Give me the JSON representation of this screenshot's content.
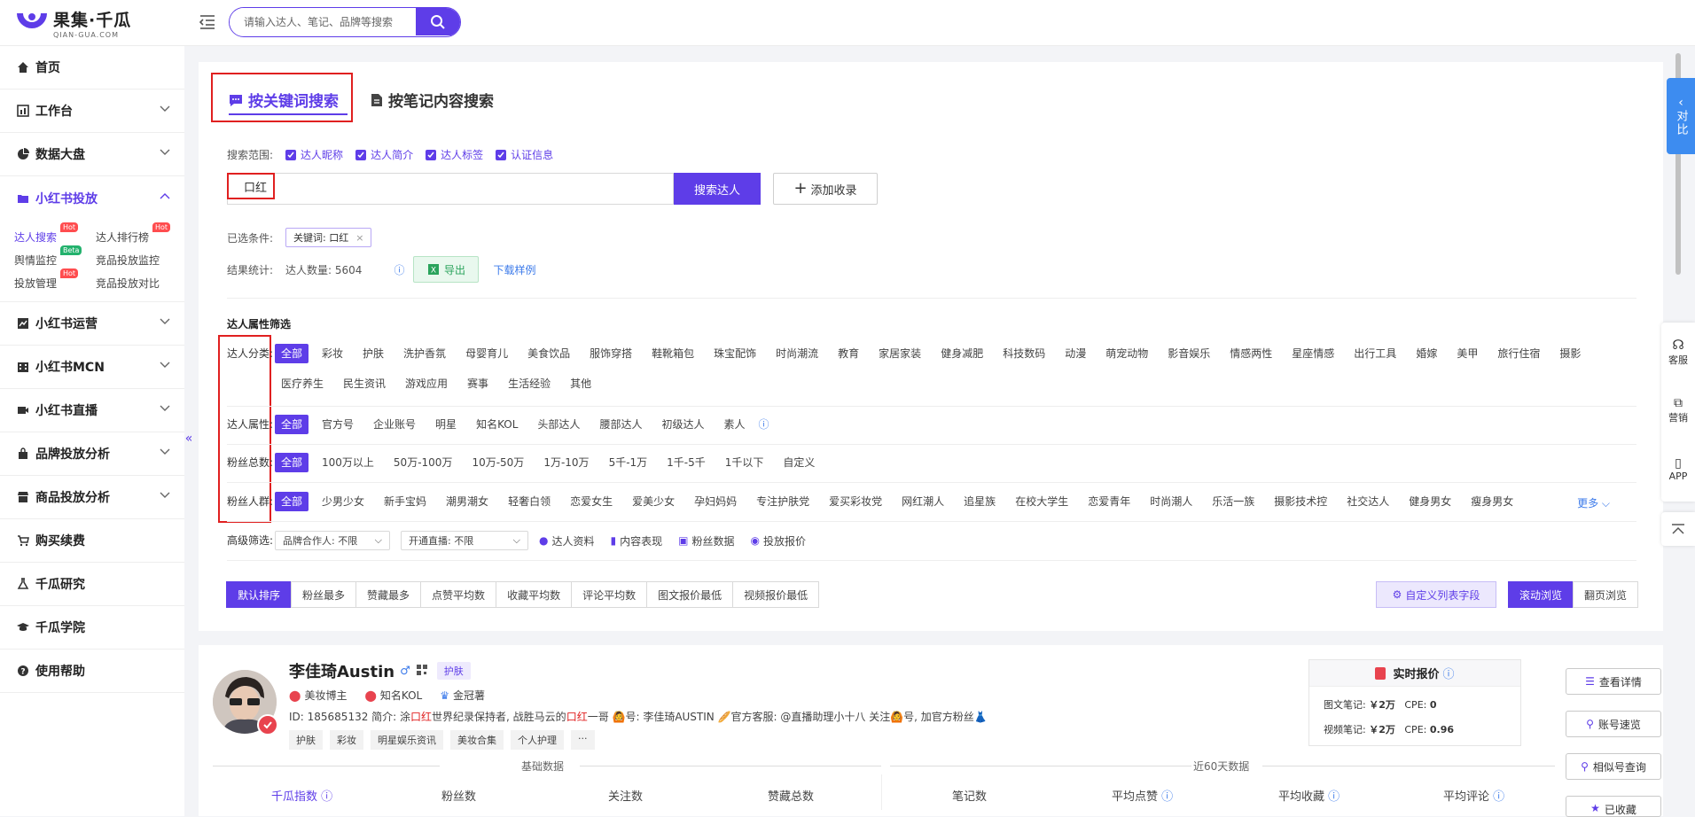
{
  "brand": {
    "title": "果集·千瓜",
    "subtitle": "QIAN-GUA.COM",
    "accent": "#5e3de8"
  },
  "search": {
    "placeholder": "请输入达人、笔记、品牌等搜索"
  },
  "sidebar": {
    "items": [
      {
        "label": "首页",
        "icon": "home-icon"
      },
      {
        "label": "工作台",
        "icon": "dashboard-icon"
      },
      {
        "label": "数据大盘",
        "icon": "pie-chart-icon"
      },
      {
        "label": "小红书投放",
        "icon": "folder-icon"
      }
    ],
    "sub": [
      {
        "label": "达人搜索",
        "badge": "Hot"
      },
      {
        "label": "达人排行榜",
        "badge": "Hot"
      },
      {
        "label": "舆情监控",
        "badge": "Beta"
      },
      {
        "label": "竞品投放监控",
        "badge": ""
      },
      {
        "label": "投放管理",
        "badge": "Hot"
      },
      {
        "label": "竞品投放对比",
        "badge": ""
      }
    ],
    "items2": [
      {
        "label": "小红书运营"
      },
      {
        "label": "小红书MCN"
      },
      {
        "label": "小红书直播"
      },
      {
        "label": "品牌投放分析"
      },
      {
        "label": "商品投放分析"
      },
      {
        "label": "购买续费"
      },
      {
        "label": "千瓜研究"
      },
      {
        "label": "千瓜学院"
      },
      {
        "label": "使用帮助"
      }
    ]
  },
  "tabs": {
    "keyword": "按关键词搜索",
    "note": "按笔记内容搜索"
  },
  "scope": {
    "label": "搜索范围:",
    "options": [
      "达人昵称",
      "达人简介",
      "达人标签",
      "认证信息"
    ]
  },
  "keyword": {
    "value": "口红",
    "search_btn": "搜索达人",
    "add_btn": "添加收录"
  },
  "conditions": {
    "label": "已选条件:",
    "tag": "关键词: 口红"
  },
  "stats": {
    "label": "结果统计:",
    "count": "达人数量: 5604",
    "export": "导出",
    "sample": "下载样例"
  },
  "filters": {
    "title": "达人属性筛选",
    "category": {
      "label": "达人分类:",
      "options": [
        "全部",
        "彩妆",
        "护肤",
        "洗护香氛",
        "母婴育儿",
        "美食饮品",
        "服饰穿搭",
        "鞋靴箱包",
        "珠宝配饰",
        "时尚潮流",
        "教育",
        "家居家装",
        "健身减肥",
        "科技数码",
        "动漫",
        "萌宠动物",
        "影音娱乐",
        "情感两性",
        "星座情感",
        "出行工具",
        "婚嫁",
        "美甲",
        "旅行住宿",
        "摄影",
        "医疗养生",
        "民生资讯",
        "游戏应用",
        "赛事",
        "生活经验",
        "其他"
      ]
    },
    "attr": {
      "label": "达人属性:",
      "options": [
        "全部",
        "官方号",
        "企业账号",
        "明星",
        "知名KOL",
        "头部达人",
        "腰部达人",
        "初级达人",
        "素人"
      ]
    },
    "fans": {
      "label": "粉丝总数:",
      "options": [
        "全部",
        "100万以上",
        "50万-100万",
        "10万-50万",
        "1万-10万",
        "5千-1万",
        "1千-5千",
        "1千以下",
        "自定义"
      ]
    },
    "crowd": {
      "label": "粉丝人群:",
      "options": [
        "全部",
        "少男少女",
        "新手宝妈",
        "潮男潮女",
        "轻奢白领",
        "恋爱女生",
        "爱美少女",
        "孕妇妈妈",
        "专注护肤党",
        "爱买彩妆党",
        "网红潮人",
        "追星族",
        "在校大学生",
        "恋爱青年",
        "时尚潮人",
        "乐活一族",
        "摄影技术控",
        "社交达人",
        "健身男女",
        "瘦身男女"
      ],
      "more": "更多"
    },
    "advanced": {
      "label": "高级筛选:",
      "brand": "品牌合作人: 不限",
      "live": "开通直播: 不限",
      "links": [
        "达人资料",
        "内容表现",
        "粉丝数据",
        "投放报价"
      ]
    }
  },
  "sort": {
    "options": [
      "默认排序",
      "粉丝最多",
      "赞藏最多",
      "点赞平均数",
      "收藏平均数",
      "评论平均数",
      "图文报价最低",
      "视频报价最低"
    ],
    "custom": "自定义列表字段",
    "views": [
      "滚动浏览",
      "翻页浏览"
    ]
  },
  "kol": {
    "name": "李佳琦Austin",
    "tag": "护肤",
    "roles": [
      "美妆博主",
      "知名KOL",
      "金冠薯"
    ],
    "bio_pre": "ID: 185685132   简介: 涂",
    "bio_hl1": "口红",
    "bio_mid": "世界纪录保持者, 战胜马云的",
    "bio_hl2": "口红",
    "bio_post": "一哥 🙆号: 李佳琦AUSTIN 🥖官方客服: @直播助理小十八 关注🙆号, 加官方粉丝👗",
    "ptags": [
      "护肤",
      "彩妆",
      "明星娱乐资讯",
      "美妆合集",
      "个人护理",
      "···"
    ],
    "price": {
      "title": "实时报价",
      "img_label": "图文笔记:",
      "img_price": "￥2万",
      "img_cpe_label": "CPE:",
      "img_cpe": "0",
      "vid_label": "视频笔记:",
      "vid_price": "￥2万",
      "vid_cpe_label": "CPE:",
      "vid_cpe": "0.96"
    },
    "actions": [
      "查看详情",
      "账号速览",
      "相似号查询",
      "已收藏"
    ],
    "groups": {
      "base": "基础数据",
      "recent": "近60天数据"
    },
    "metrics": [
      "千瓜指数",
      "粉丝数",
      "关注数",
      "赞藏总数",
      "笔记数",
      "平均点赞",
      "平均收藏",
      "平均评论"
    ]
  },
  "right": {
    "compare": "对比",
    "tools": [
      "客服",
      "营销",
      "APP"
    ]
  }
}
